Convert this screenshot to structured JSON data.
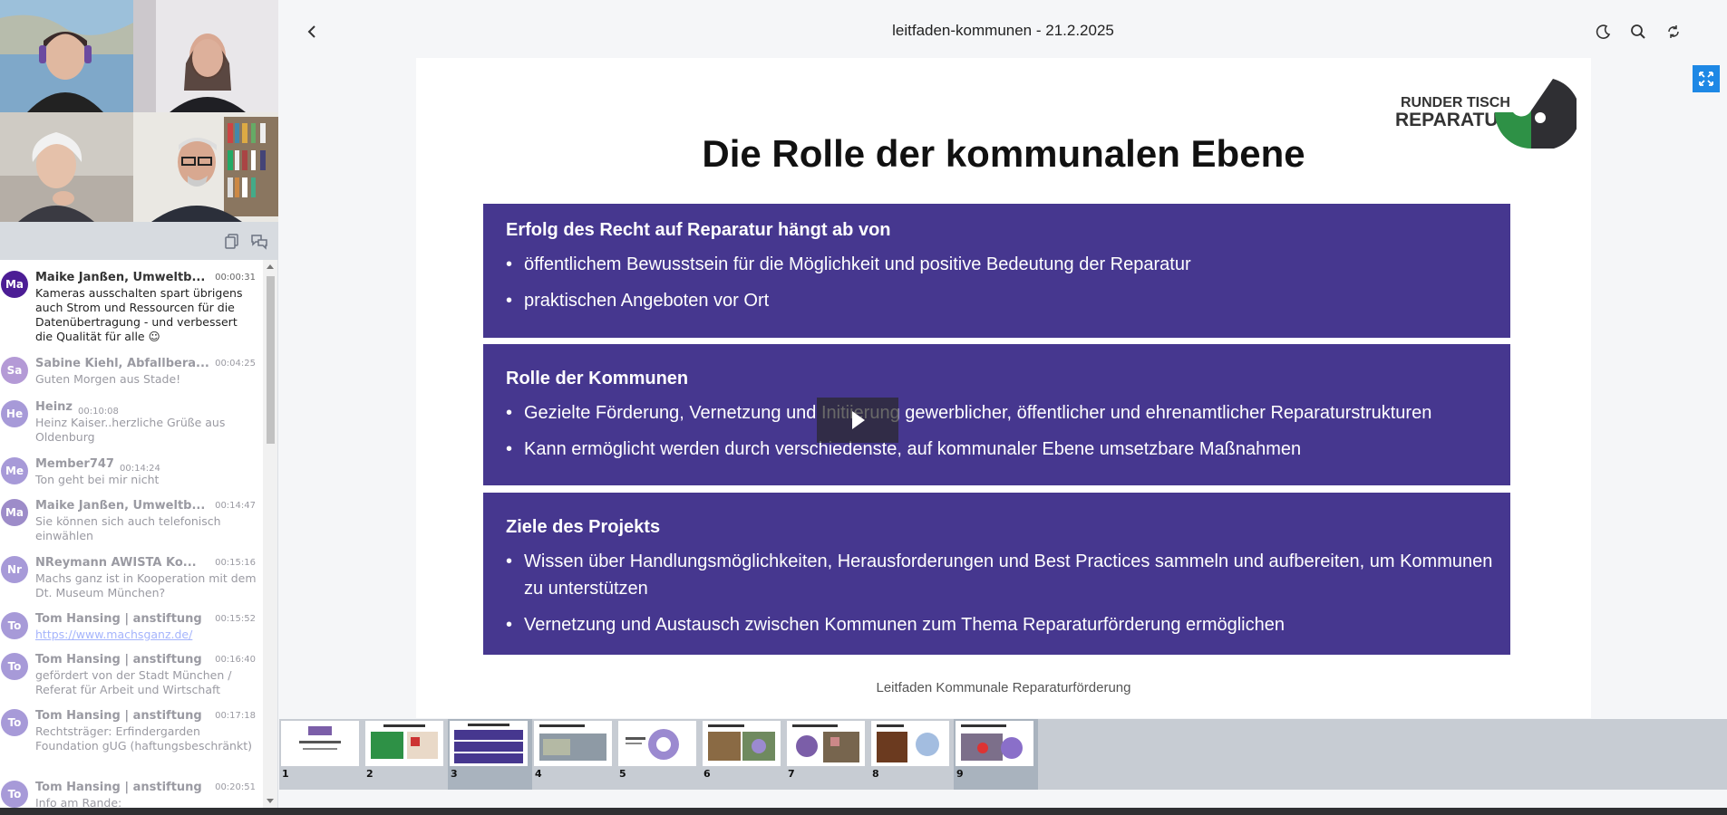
{
  "header": {
    "title": "leitfaden-kommunen - 21.2.2025"
  },
  "chat": {
    "messages": [
      {
        "initials": "Ma",
        "name": "Maike Janßen, Umweltb...",
        "time": "00:00:31",
        "text": "Kameras ausschalten spart übrigens auch Strom und Ressourcen für die Datenübertragung - und verbessert die Qualität für alle ☺",
        "color": "#4c1d95"
      },
      {
        "initials": "Sa",
        "name": "Sabine Kiehl, Abfallbera...",
        "time": "00:04:25",
        "text": "Guten Morgen aus Stade!",
        "color": "#b49ad6"
      },
      {
        "initials": "He",
        "name": "Heinz",
        "time": "00:10:08",
        "text": "Heinz Kaiser..herzliche Grüße aus Oldenburg",
        "color": "#a79ad8"
      },
      {
        "initials": "Me",
        "name": "Member747",
        "time": "00:14:24",
        "text": "Ton geht bei mir nicht",
        "color": "#a79ad8"
      },
      {
        "initials": "Ma",
        "name": "Maike Janßen, Umweltb...",
        "time": "00:14:47",
        "text": "Sie können sich auch telefonisch einwählen",
        "color": "#9d8cc9"
      },
      {
        "initials": "Nr",
        "name": "NReymann AWISTA Ko...",
        "time": "00:15:16",
        "text": "Machs ganz ist in Kooperation mit dem Dt. Museum München?",
        "color": "#a79ad8"
      },
      {
        "initials": "To",
        "name": "Tom Hansing | anstiftung",
        "time": "00:15:52",
        "text": "https://www.machsganz.de/",
        "color": "#a79ad8"
      },
      {
        "initials": "To",
        "name": "Tom Hansing | anstiftung",
        "time": "00:16:40",
        "text": "gefördert von der Stadt München / Referat für Arbeit und Wirtschaft",
        "color": "#a79ad8"
      },
      {
        "initials": "To",
        "name": "Tom Hansing | anstiftung",
        "time": "00:17:18",
        "text": "Rechtsträger: Erfindergarden Foundation gUG (haftungsbeschränkt)",
        "color": "#a79ad8"
      },
      {
        "initials": "To",
        "name": "Tom Hansing | anstiftung",
        "time": "00:20:51",
        "text": "Info am Rande:",
        "color": "#a79ad8"
      }
    ]
  },
  "slide": {
    "logo_line1": "RUNDER TISCH",
    "logo_line2": "REPARATUR",
    "title": "Die Rolle der kommunalen Ebene",
    "boxes": [
      {
        "title": "Erfolg des Recht auf Reparatur hängt ab von",
        "bullets": [
          "öffentlichem Bewusstsein für die Möglichkeit und positive Bedeutung der Reparatur",
          "praktischen Angeboten vor Ort"
        ]
      },
      {
        "title": "Rolle der Kommunen",
        "bullets": [
          "Gezielte Förderung, Vernetzung und Initiierung gewerblicher, öffentlicher und ehrenamtlicher Reparaturstrukturen",
          "Kann ermöglicht werden durch verschiedenste, auf kommunaler Ebene umsetzbare Maßnahmen"
        ]
      },
      {
        "title": "Ziele des Projekts",
        "bullets": [
          "Wissen über Handlungsmöglichkeiten, Herausforderungen und Best Practices sammeln und aufbereiten, um Kommunen zu unterstützen",
          "Vernetzung und Austausch zwischen Kommunen zum Thema Reparaturförderung ermöglichen"
        ]
      }
    ],
    "footer": "Leitfaden Kommunale Reparaturförderung"
  },
  "thumbnails": {
    "pages": [
      "1",
      "2",
      "3",
      "4",
      "5",
      "6",
      "7",
      "8",
      "9"
    ],
    "active": [
      "3",
      "9"
    ]
  },
  "colors": {
    "box_purple": "#46378f",
    "expand_blue": "#1e88e5"
  }
}
